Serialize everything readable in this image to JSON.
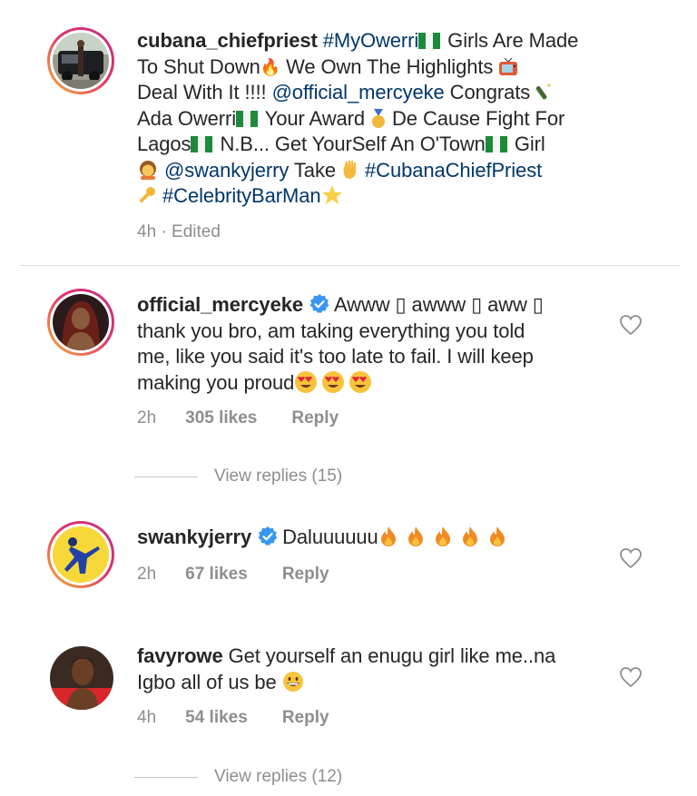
{
  "post": {
    "username": "cubana_chiefpriest",
    "line1_tag": "#MyOwerri",
    "line1_rest": " Girls Are Made",
    "line2": "To Shut Down",
    "line2b": " We Own The Highlights ",
    "line3_a": "Deal With It !!!! ",
    "line3_tag": "@official_mercyeke",
    "line3_b": " Congrats ",
    "line4_a": "Ada Owerri",
    "line4_b": " Your Award ",
    "line4_c": " De Cause Fight For",
    "line5_a": "Lagos",
    "line5_b": " N.B... Get YourSelf An O'Town",
    "line5_c": " Girl",
    "line6_tag1": "@swankyjerry",
    "line6_a": " Take ",
    "line6_tag2": "#CubanaChiefPriest",
    "line7_tag": "#CelebrityBarMan",
    "time": "4h · Edited"
  },
  "comments": [
    {
      "username": "official_mercyeke",
      "verified": true,
      "text_line1": "Awww ▯ awww ▯ aww ▯",
      "text_line2": "thank you bro, am taking everything you told",
      "text_line3": "me, like you said it's too late to fail.  I will keep",
      "text_line4": "making you proud",
      "time": "2h",
      "likes": "305 likes",
      "reply": "Reply",
      "view_replies": "View replies (15)"
    },
    {
      "username": "swankyjerry",
      "verified": true,
      "text_line1": "Daluuuuuu",
      "time": "2h",
      "likes": "67 likes",
      "reply": "Reply"
    },
    {
      "username": "favyrowe",
      "verified": false,
      "text_line1": "Get yourself an enugu girl like me..na",
      "text_line2": "Igbo all of us be",
      "time": "4h",
      "likes": "54 likes",
      "reply": "Reply",
      "view_replies": "View replies (12)"
    }
  ],
  "colors": {
    "link": "#00376b",
    "muted": "#8e8e8e",
    "verified": "#3897f0",
    "divider": "#dbdbdb"
  },
  "icons": [
    "heart-icon",
    "verified-badge-icon",
    "nigeria-flag-icon",
    "fire-emoji",
    "heart-eyes-emoji",
    "grinning-emoji"
  ]
}
